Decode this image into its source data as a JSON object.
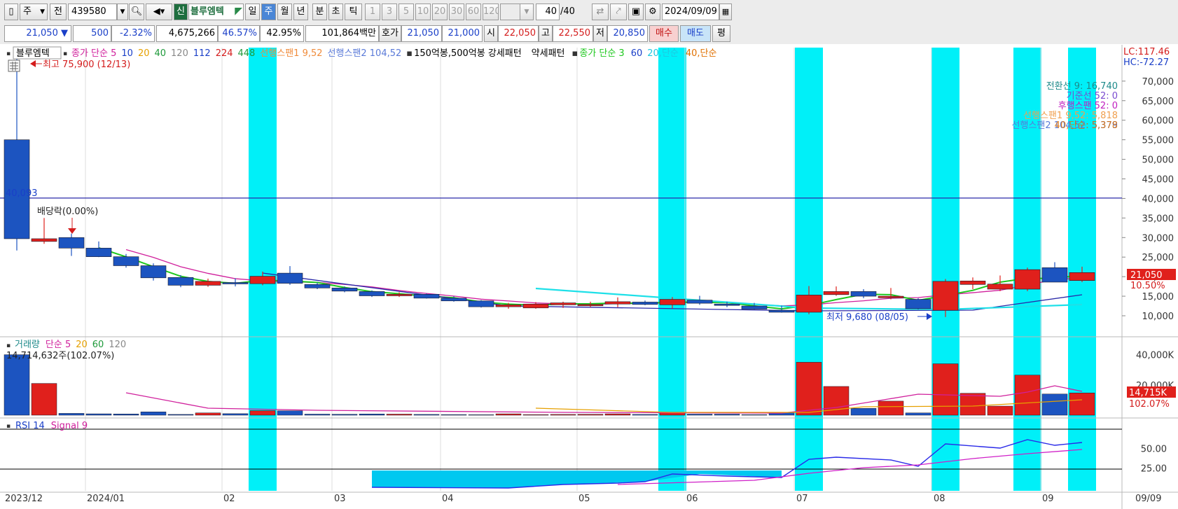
{
  "toolbar": {
    "period": "주",
    "mode": "전",
    "code": "439580",
    "badge_new": "신",
    "stock_name": "블루엠텍",
    "tabs": [
      "일",
      "주",
      "월",
      "년",
      "분",
      "초",
      "틱"
    ],
    "active_tab": "주",
    "intervals": [
      "1",
      "3",
      "5",
      "10",
      "20",
      "30",
      "60",
      "120"
    ],
    "count_value": "40",
    "count_total": "/40",
    "date": "2024/09/09"
  },
  "quote": {
    "price": "21,050",
    "arrow": "▼",
    "change": "500",
    "change_pct": "-2.32%",
    "volume": "4,675,266",
    "pct1": "46.57%",
    "pct2": "42.95%",
    "amount": "101,864백만",
    "ask_label": "호가",
    "ask1": "21,050",
    "ask2": "21,000",
    "open_label": "시",
    "open": "22,050",
    "high_label": "고",
    "high": "22,550",
    "low_label": "저",
    "low": "20,850",
    "buy": "매수",
    "sell": "매도",
    "flat": "평"
  },
  "legend": {
    "name": "블루엠텍",
    "ma_title": "종가 단순 5",
    "ma_periods": [
      "10",
      "20",
      "40",
      "120",
      "112",
      "224",
      "448"
    ],
    "span1": "선행스팬1 9,52",
    "span2": "선행스팬2 104,52",
    "pattern_strong": "150억봉,500억봉 강세패턴",
    "pattern_weak": "약세패턴",
    "ma2_title": "종가 단순 3",
    "ma2_60": "60",
    "ma2_20": "20,단순",
    "ma2_40": "40,단순"
  },
  "ichimoku": {
    "conversion": "전환선 9: 16,740",
    "base": "기준선 52: 0",
    "lagging": "후행스팬 52: 0",
    "span1": "선행스팬1 9,52: 5,818",
    "span2": "선행스팬2 104,52: 5,379",
    "ma40": "40,단순: 5,378"
  },
  "annotations": {
    "high": "최고 75,900 (12/13)",
    "low": "최저 9,680 (08/05)",
    "dividend": "배당락(0.00%)",
    "hline_value": "40,093"
  },
  "right_info": {
    "lc": "LC:117.46",
    "hc": "HC:-72.27",
    "price_tag": "21,050",
    "pct_tag": "10.50%",
    "vol_tag": "14,715K",
    "vol_pct_tag": "102.07%"
  },
  "volume_panel": {
    "title": "거래량",
    "ma": "단순 5",
    "ma_periods": [
      "20",
      "60",
      "120"
    ],
    "info": "14,714,632주(102.07%)"
  },
  "rsi_panel": {
    "title": "RSI 14",
    "signal": "Signal 9"
  },
  "x_labels": [
    "2023/12",
    "2024/01",
    "02",
    "03",
    "04",
    "05",
    "06",
    "07",
    "08",
    "09"
  ],
  "last_date_label": "09/09",
  "chart_data": {
    "type": "candlestick",
    "title": "블루엠텍",
    "period": "weekly",
    "candles": [
      {
        "o": 55000,
        "h": 75900,
        "l": 26700,
        "c": 29700
      },
      {
        "o": 29000,
        "h": 35000,
        "l": 28400,
        "c": 29700
      },
      {
        "o": 30000,
        "h": 31000,
        "l": 25300,
        "c": 27300
      },
      {
        "o": 27300,
        "h": 29000,
        "l": 25000,
        "c": 25100
      },
      {
        "o": 25100,
        "h": 25800,
        "l": 22300,
        "c": 22800
      },
      {
        "o": 22800,
        "h": 23400,
        "l": 19000,
        "c": 19700
      },
      {
        "o": 19800,
        "h": 20400,
        "l": 17300,
        "c": 17800
      },
      {
        "o": 17800,
        "h": 19500,
        "l": 17400,
        "c": 18800
      },
      {
        "o": 18500,
        "h": 19600,
        "l": 17500,
        "c": 18300
      },
      {
        "o": 18200,
        "h": 21300,
        "l": 17800,
        "c": 20100
      },
      {
        "o": 20900,
        "h": 22700,
        "l": 17900,
        "c": 18300
      },
      {
        "o": 18000,
        "h": 18500,
        "l": 16800,
        "c": 17100
      },
      {
        "o": 17100,
        "h": 17500,
        "l": 16000,
        "c": 16300
      },
      {
        "o": 16200,
        "h": 16500,
        "l": 14800,
        "c": 15100
      },
      {
        "o": 15100,
        "h": 16000,
        "l": 14800,
        "c": 15500
      },
      {
        "o": 15500,
        "h": 15700,
        "l": 14400,
        "c": 14500
      },
      {
        "o": 14500,
        "h": 15000,
        "l": 13600,
        "c": 13800
      },
      {
        "o": 13800,
        "h": 14000,
        "l": 12100,
        "c": 12300
      },
      {
        "o": 12300,
        "h": 13300,
        "l": 11800,
        "c": 12800
      },
      {
        "o": 12000,
        "h": 13500,
        "l": 11800,
        "c": 13000
      },
      {
        "o": 12800,
        "h": 13600,
        "l": 12000,
        "c": 13300
      },
      {
        "o": 12800,
        "h": 13600,
        "l": 12200,
        "c": 12900
      },
      {
        "o": 13000,
        "h": 14700,
        "l": 12200,
        "c": 13600
      },
      {
        "o": 13500,
        "h": 13900,
        "l": 12700,
        "c": 12900
      },
      {
        "o": 12800,
        "h": 14800,
        "l": 11900,
        "c": 14200
      },
      {
        "o": 14000,
        "h": 15100,
        "l": 12800,
        "c": 13200
      },
      {
        "o": 13000,
        "h": 13600,
        "l": 12200,
        "c": 12700
      },
      {
        "o": 12500,
        "h": 13300,
        "l": 11500,
        "c": 11700
      },
      {
        "o": 11400,
        "h": 12600,
        "l": 10800,
        "c": 10900
      },
      {
        "o": 10900,
        "h": 17600,
        "l": 10400,
        "c": 15300
      },
      {
        "o": 15400,
        "h": 17500,
        "l": 15100,
        "c": 16200
      },
      {
        "o": 16200,
        "h": 16800,
        "l": 14500,
        "c": 15000
      },
      {
        "o": 14600,
        "h": 17100,
        "l": 14200,
        "c": 15000
      },
      {
        "o": 14200,
        "h": 14500,
        "l": 11600,
        "c": 11800
      },
      {
        "o": 11400,
        "h": 19400,
        "l": 9680,
        "c": 18800
      },
      {
        "o": 18000,
        "h": 19800,
        "l": 16800,
        "c": 18900
      },
      {
        "o": 16800,
        "h": 20300,
        "l": 16300,
        "c": 18100
      },
      {
        "o": 16800,
        "h": 22300,
        "l": 16300,
        "c": 21800
      },
      {
        "o": 22300,
        "h": 23700,
        "l": 18600,
        "c": 18600
      },
      {
        "o": 19000,
        "h": 22550,
        "l": 18600,
        "c": 21050
      }
    ],
    "highlight_weeks": [
      9,
      24,
      29,
      34,
      37,
      39
    ],
    "volume_k": [
      40000,
      21000,
      1200,
      900,
      800,
      2200,
      500,
      1500,
      1000,
      3000,
      2900,
      700,
      600,
      800,
      700,
      500,
      400,
      300,
      900,
      400,
      500,
      600,
      900,
      500,
      2000,
      700,
      700,
      400,
      1800,
      35000,
      19000,
      4500,
      9300,
      1500,
      34000,
      14500,
      6000,
      26500,
      14000,
      14715
    ],
    "y_axis_ticks": [
      "10,000",
      "15,000",
      "20,000",
      "25,000",
      "30,000",
      "35,000",
      "40,000",
      "45,000",
      "50,000",
      "55,000",
      "60,000",
      "65,000",
      "70,000"
    ],
    "vol_axis_ticks": [
      "20,000K",
      "40,000K"
    ],
    "rsi_axis_ticks": [
      "25.00",
      "50.00"
    ],
    "hline": 40093
  }
}
